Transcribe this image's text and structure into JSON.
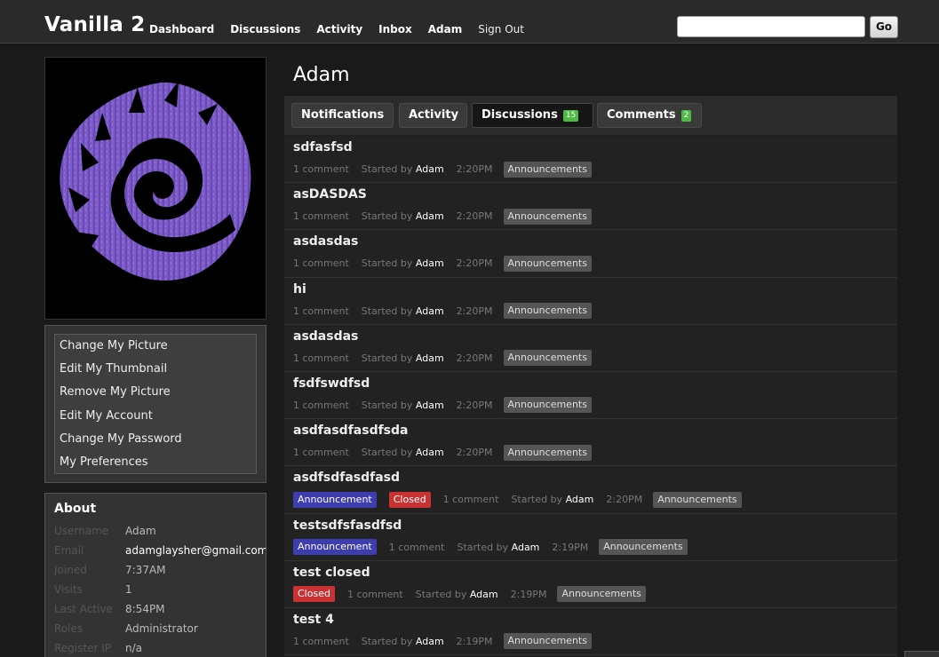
{
  "header": {
    "brand": "Vanilla 2",
    "nav": [
      "Dashboard",
      "Discussions",
      "Activity",
      "Inbox",
      "Adam",
      "Sign Out"
    ],
    "search_placeholder": "",
    "go_label": "Go"
  },
  "profile": {
    "name": "Adam",
    "picture_menu": [
      "Change My Picture",
      "Edit My Thumbnail",
      "Remove My Picture",
      "Edit My Account",
      "Change My Password",
      "My Preferences"
    ],
    "about": {
      "heading": "About",
      "rows": [
        {
          "key": "Username",
          "value": "Adam"
        },
        {
          "key": "Email",
          "value": "adamglaysher@gmail.com"
        },
        {
          "key": "Joined",
          "value": "7:37AM"
        },
        {
          "key": "Visits",
          "value": "1"
        },
        {
          "key": "Last Active",
          "value": "8:54PM"
        },
        {
          "key": "Roles",
          "value": "Administrator"
        },
        {
          "key": "Register IP",
          "value": "n/a"
        }
      ]
    }
  },
  "tabs": [
    {
      "label": "Notifications",
      "count": ""
    },
    {
      "label": "Activity",
      "count": ""
    },
    {
      "label": "Discussions",
      "count": "15"
    },
    {
      "label": "Comments",
      "count": "2"
    }
  ],
  "discussions": [
    {
      "title": "sdfasfsd",
      "tags": [],
      "comments": "1 comment",
      "started_label": "Started by",
      "author": "Adam",
      "time": "2:20PM",
      "category": "Announcements"
    },
    {
      "title": "asDASDAS",
      "tags": [],
      "comments": "1 comment",
      "started_label": "Started by",
      "author": "Adam",
      "time": "2:20PM",
      "category": "Announcements"
    },
    {
      "title": "asdasdas",
      "tags": [],
      "comments": "1 comment",
      "started_label": "Started by",
      "author": "Adam",
      "time": "2:20PM",
      "category": "Announcements"
    },
    {
      "title": "hi",
      "tags": [],
      "comments": "1 comment",
      "started_label": "Started by",
      "author": "Adam",
      "time": "2:20PM",
      "category": "Announcements"
    },
    {
      "title": "asdasdas",
      "tags": [],
      "comments": "1 comment",
      "started_label": "Started by",
      "author": "Adam",
      "time": "2:20PM",
      "category": "Announcements"
    },
    {
      "title": "fsdfswdfsd",
      "tags": [],
      "comments": "1 comment",
      "started_label": "Started by",
      "author": "Adam",
      "time": "2:20PM",
      "category": "Announcements"
    },
    {
      "title": "asdfasdfasdfsda",
      "tags": [],
      "comments": "1 comment",
      "started_label": "Started by",
      "author": "Adam",
      "time": "2:20PM",
      "category": "Announcements"
    },
    {
      "title": "asdfsdfasdfasd",
      "tags": [
        "Announcement",
        "Closed"
      ],
      "comments": "1 comment",
      "started_label": "Started by",
      "author": "Adam",
      "time": "2:20PM",
      "category": "Announcements"
    },
    {
      "title": "testsdfsfasdfsd",
      "tags": [
        "Announcement"
      ],
      "comments": "1 comment",
      "started_label": "Started by",
      "author": "Adam",
      "time": "2:19PM",
      "category": "Announcements"
    },
    {
      "title": "test closed",
      "tags": [
        "Closed"
      ],
      "comments": "1 comment",
      "started_label": "Started by",
      "author": "Adam",
      "time": "2:19PM",
      "category": "Announcements"
    },
    {
      "title": "test 4",
      "tags": [],
      "comments": "1 comment",
      "started_label": "Started by",
      "author": "Adam",
      "time": "2:19PM",
      "category": "Announcements"
    }
  ],
  "colors": {
    "announcement_tag": "#3d3dae",
    "closed_tag": "#c83232",
    "count_badge": "#4fb946",
    "avatar_purple": "#7d5bc9"
  },
  "icons": {
    "avatar": "zerg-emblem-picture"
  }
}
